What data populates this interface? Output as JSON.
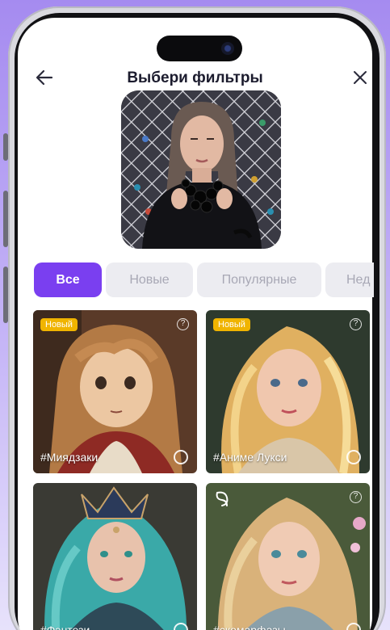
{
  "header": {
    "title": "Выбери фильтры",
    "back_icon": "arrow-left-icon",
    "close_icon": "close-icon"
  },
  "tabs": [
    {
      "label": "Все",
      "active": true
    },
    {
      "label": "Новые",
      "active": false
    },
    {
      "label": "Популярные",
      "active": false
    },
    {
      "label": "Нед",
      "active": false
    }
  ],
  "filters": [
    {
      "label": "#Миядзаки",
      "badge": "Новый",
      "help": "?"
    },
    {
      "label": "#Аниме Лукси",
      "badge": "Новый",
      "help": "?"
    },
    {
      "label": "#Фэнтези",
      "badge": "",
      "help": "?"
    },
    {
      "label": "#скомарфазы",
      "badge": "",
      "help": "?"
    }
  ],
  "colors": {
    "accent": "#7a3ff0",
    "badge": "#f0b400",
    "tab_inactive_bg": "#ececf1",
    "tab_inactive_text": "#a8a8b5"
  }
}
